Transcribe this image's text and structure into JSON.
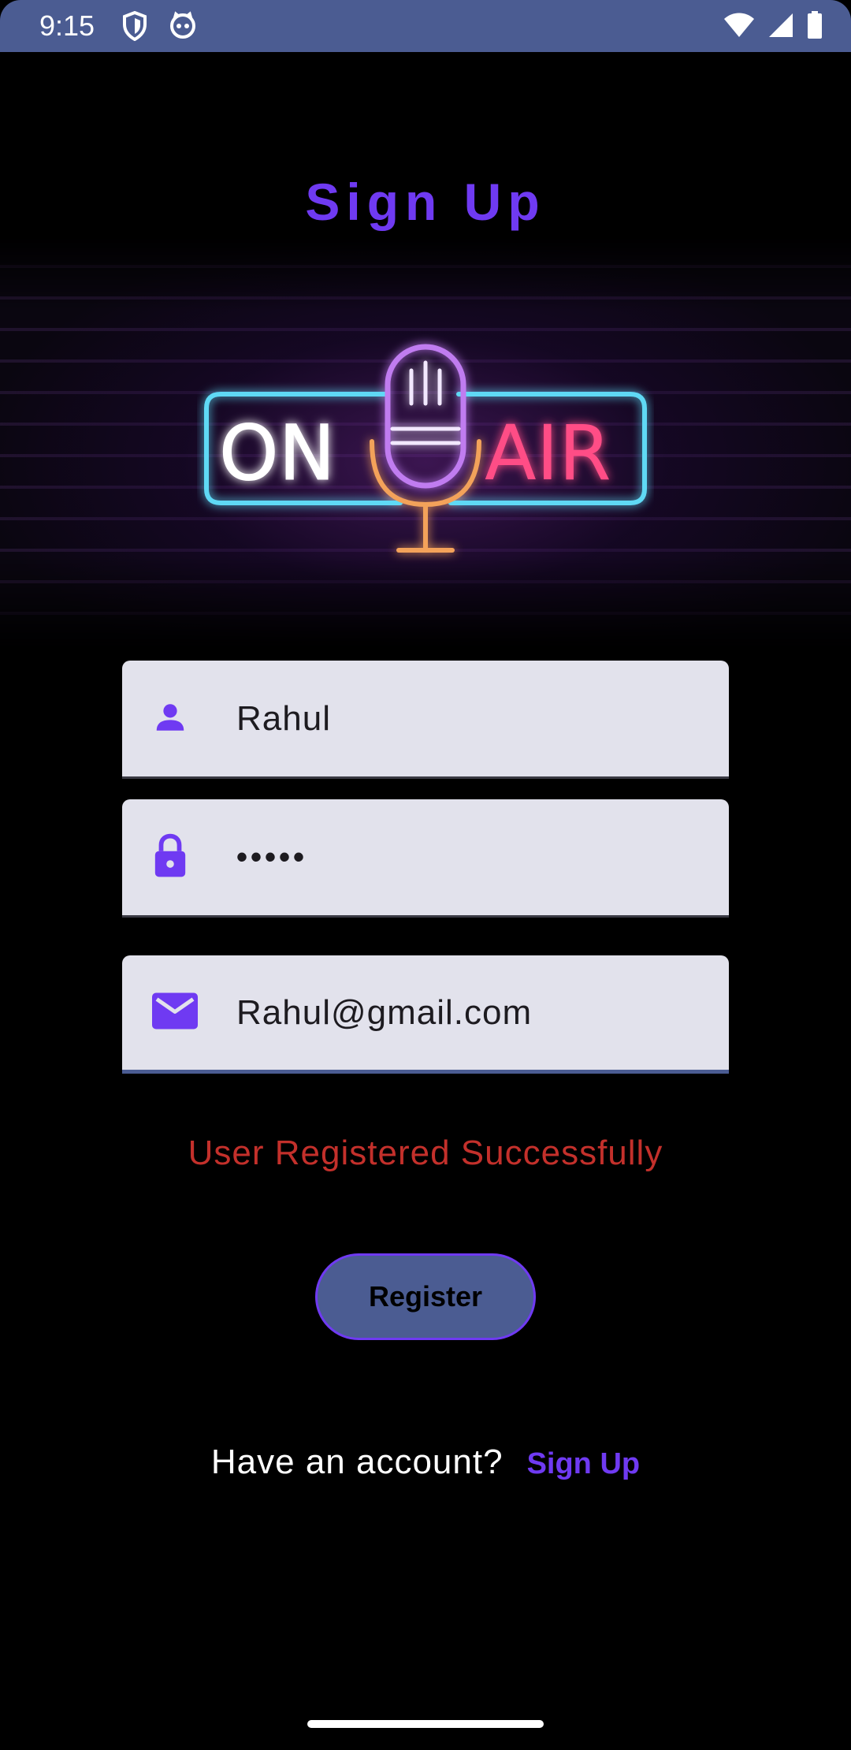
{
  "status_bar": {
    "time": "9:15",
    "left_icons": [
      "shield-icon",
      "cat-face-icon"
    ],
    "right_icons": [
      "wifi-icon",
      "cellular-signal-icon",
      "battery-icon"
    ]
  },
  "page": {
    "title": "Sign Up"
  },
  "logo": {
    "left_word": "ON",
    "right_word": "AIR",
    "icon": "microphone-icon",
    "colors": {
      "frame": "#5fd9f5",
      "mic": "#c07cf0",
      "stand": "#f3a25a",
      "air_text": "#ff4e86"
    }
  },
  "form": {
    "username": {
      "icon": "person-icon",
      "value": "Rahul"
    },
    "password": {
      "icon": "lock-icon",
      "value": "•••••"
    },
    "email": {
      "icon": "email-icon",
      "value": "Rahul@gmail.com"
    }
  },
  "status_message": "User Registered Successfully",
  "register_button": {
    "label": "Register"
  },
  "footer": {
    "text": "Have an account?",
    "link": "Sign Up"
  },
  "colors": {
    "accent": "#6f3af2",
    "status_bar": "#4b5c92",
    "button": "#4b5c92",
    "field_bg": "#e2e2ec",
    "message": "#c3302b"
  }
}
